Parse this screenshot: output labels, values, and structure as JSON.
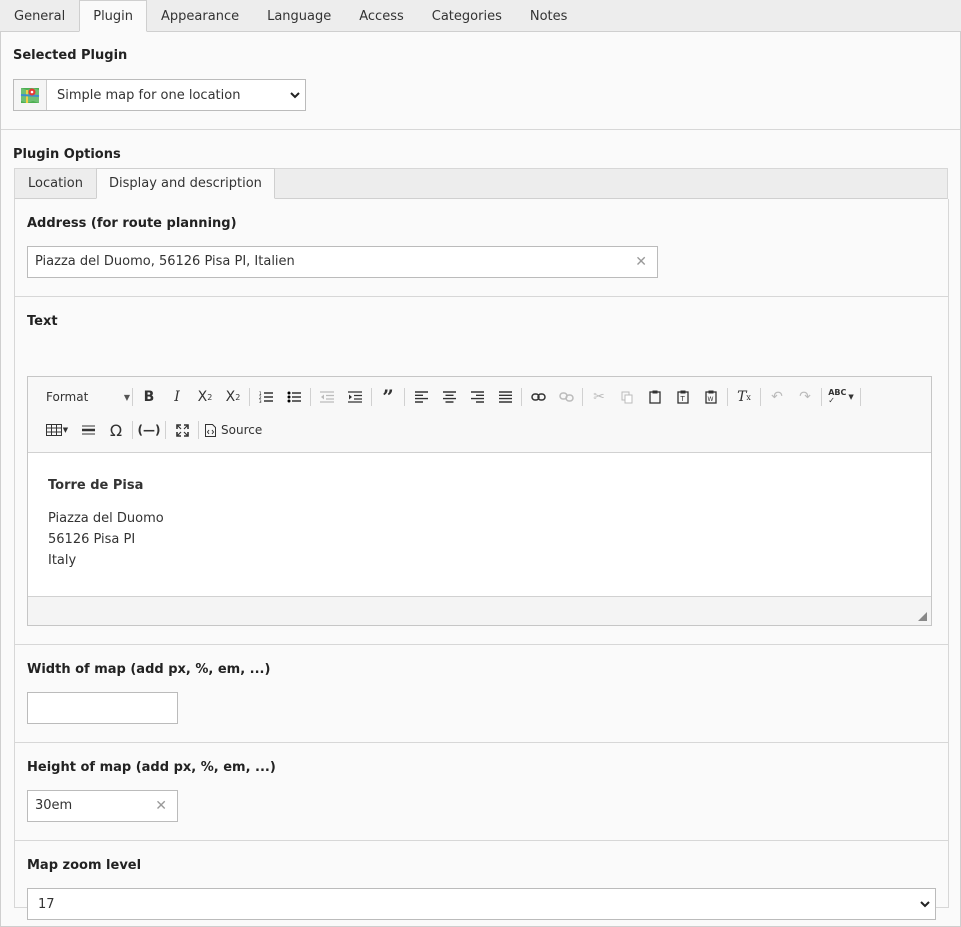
{
  "top_tabs": [
    "General",
    "Plugin",
    "Appearance",
    "Language",
    "Access",
    "Categories",
    "Notes"
  ],
  "selected_plugin": {
    "label": "Selected Plugin",
    "value": "Simple map for one location",
    "icon": "map-icon"
  },
  "plugin_options": {
    "label": "Plugin Options",
    "tabs": [
      "Location",
      "Display and description"
    ]
  },
  "address": {
    "label": "Address (for route planning)",
    "value": "Piazza del Duomo, 56126 Pisa PI, Italien"
  },
  "text_editor": {
    "label": "Text",
    "format_label": "Format",
    "source_label": "Source",
    "content": {
      "heading": "Torre de Pisa",
      "lines": [
        "Piazza del Duomo",
        "56126 Pisa PI",
        "Italy"
      ]
    }
  },
  "width": {
    "label": "Width of map (add px, %, em, ...)",
    "value": ""
  },
  "height": {
    "label": "Height of map (add px, %, em, ...)",
    "value": "30em"
  },
  "zoom": {
    "label": "Map zoom level",
    "value": "17"
  }
}
